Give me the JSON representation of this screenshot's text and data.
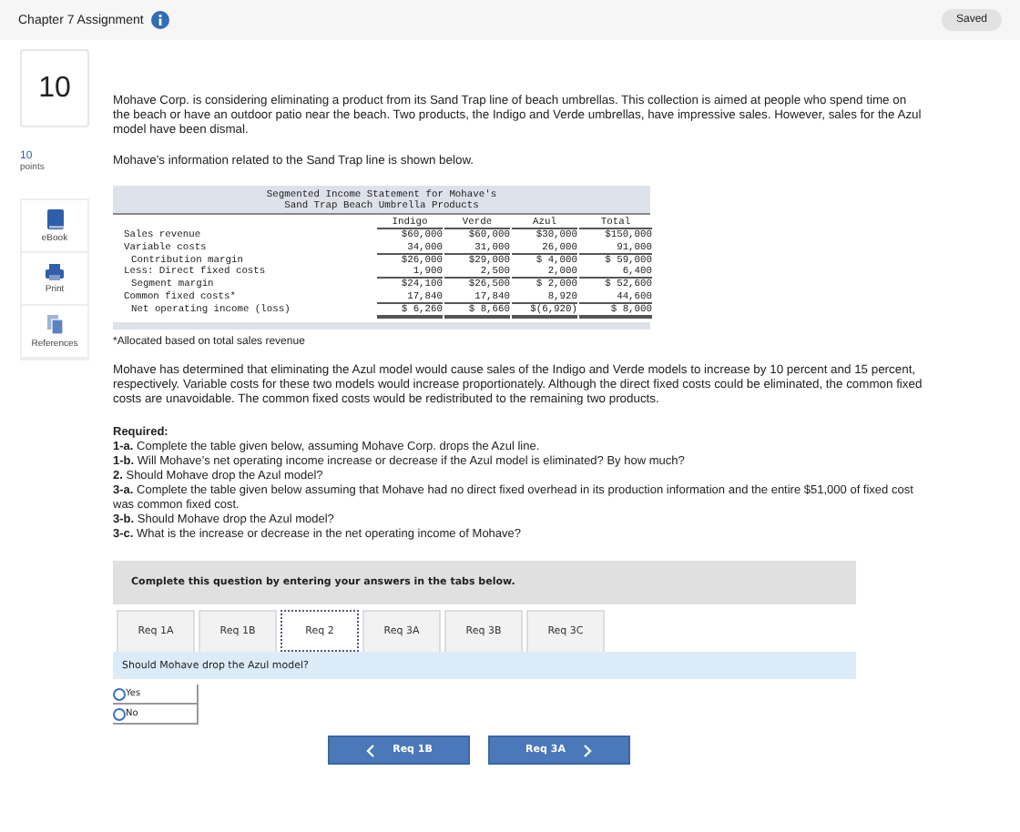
{
  "header": {
    "title": "Chapter 7 Assignment",
    "status": "Saved"
  },
  "question": {
    "number": "10",
    "points_value": "10",
    "points_label": "points"
  },
  "sidebar": {
    "items": [
      {
        "label": "eBook",
        "kind": "book"
      },
      {
        "label": "Print",
        "kind": "print"
      },
      {
        "label": "References",
        "kind": "references"
      }
    ]
  },
  "intro": [
    "Mohave Corp. is considering eliminating a product from its Sand Trap line of beach umbrellas. This collection is aimed at people who spend time on the beach or have an outdoor patio near the beach. Two products, the Indigo and Verde umbrellas, have impressive sales. However, sales for the Azul model have been dismal.",
    "Mohave’s information related to the Sand Trap line is shown below."
  ],
  "table": {
    "title_lines": [
      "Segmented Income Statement for Mohave's",
      "Sand Trap Beach Umbrella Products"
    ],
    "columns": [
      "Indigo",
      "Verde",
      "Azul",
      "Total"
    ],
    "rows": [
      {
        "label": "Sales revenue",
        "kind": "item",
        "values": [
          "$60,000",
          "$60,000",
          "$30,000",
          "$150,000"
        ]
      },
      {
        "label": "Variable costs",
        "kind": "ruled",
        "values": [
          "34,000",
          "31,000",
          "26,000",
          "91,000"
        ]
      },
      {
        "label": "Contribution margin",
        "kind": "subtotal",
        "values": [
          "$26,000",
          "$29,000",
          "$ 4,000",
          "$ 59,000"
        ]
      },
      {
        "label": "Less: Direct fixed costs",
        "kind": "ruled",
        "values": [
          "1,900",
          "2,500",
          "2,000",
          "6,400"
        ]
      },
      {
        "label": "Segment margin",
        "kind": "subtotal",
        "values": [
          "$24,100",
          "$26,500",
          "$ 2,000",
          "$ 52,600"
        ]
      },
      {
        "label": "Common fixed costs*",
        "kind": "ruled",
        "values": [
          "17,840",
          "17,840",
          "8,920",
          "44,600"
        ]
      },
      {
        "label": "Net operating income (loss)",
        "kind": "total",
        "values": [
          "$ 6,260",
          "$ 8,660",
          "$(6,920)",
          "$ 8,000"
        ]
      }
    ]
  },
  "footnote": "*Allocated based on total sales revenue",
  "paragraph": "Mohave has determined that eliminating the Azul model would cause sales of the Indigo and Verde models to increase by 10 percent and 15 percent, respectively. Variable costs for these two models would increase proportionately. Although the direct fixed costs could be eliminated, the common fixed costs are unavoidable. The common fixed costs would be redistributed to the remaining two products.",
  "required": {
    "heading": "Required:",
    "items": [
      "**1-a.** Complete the table given below, assuming Mohave Corp. drops the Azul line.",
      "**1-b.** Will Mohave’s net operating income increase or decrease if the Azul model is eliminated? By how much?",
      "**2.** Should Mohave drop the Azul model?",
      "**3-a.** Complete the table given below assuming that Mohave had no direct fixed overhead in its production information and the entire $51,000 of fixed cost was common fixed cost.",
      "**3-b.** Should Mohave drop the Azul model?",
      "**3-c.** What is the increase or decrease in the net operating income of Mohave?"
    ]
  },
  "instruction": "Complete this question by entering your answers in the tabs below.",
  "tabs": [
    {
      "label": "Req 1A",
      "selected": false
    },
    {
      "label": "Req 1B",
      "selected": false
    },
    {
      "label": "Req 2",
      "selected": true
    },
    {
      "label": "Req 3A",
      "selected": false
    },
    {
      "label": "Req 3B",
      "selected": false
    },
    {
      "label": "Req 3C",
      "selected": false
    }
  ],
  "prompt": "Should Mohave drop the Azul model?",
  "options": [
    {
      "label": "Yes",
      "selected": false
    },
    {
      "label": "No",
      "selected": false
    }
  ],
  "nav": [
    {
      "label": "Req 1B",
      "kind": "prev"
    },
    {
      "label": "Req 3A",
      "kind": "next"
    }
  ]
}
